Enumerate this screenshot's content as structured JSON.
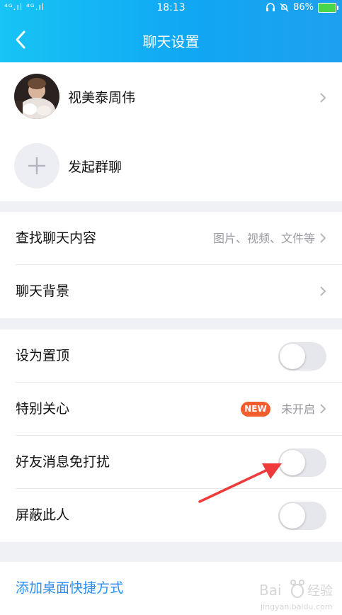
{
  "status_bar": {
    "signal_left": "⁴ᴳ.ıl ⁴ᴳ.ıl",
    "time": "18:13",
    "battery_percent": "86%"
  },
  "header": {
    "title": "聊天设置"
  },
  "contact": {
    "name": "视美泰周伟"
  },
  "group_chat": {
    "label": "发起群聊"
  },
  "search_history": {
    "label": "查找聊天内容",
    "hint": "图片、视频、文件等"
  },
  "chat_background": {
    "label": "聊天背景"
  },
  "pin_top": {
    "label": "设为置顶",
    "on": false
  },
  "special_care": {
    "label": "特别关心",
    "badge": "NEW",
    "status": "未开启"
  },
  "mute": {
    "label": "好友消息免打扰",
    "on": false
  },
  "block": {
    "label": "屏蔽此人",
    "on": false
  },
  "shortcut": {
    "label": "添加桌面快捷方式"
  },
  "colors": {
    "header": "#10a7f3",
    "link": "#2b8ef3",
    "badge": "#f45d2e",
    "annotation_arrow": "#ee3a3a"
  }
}
